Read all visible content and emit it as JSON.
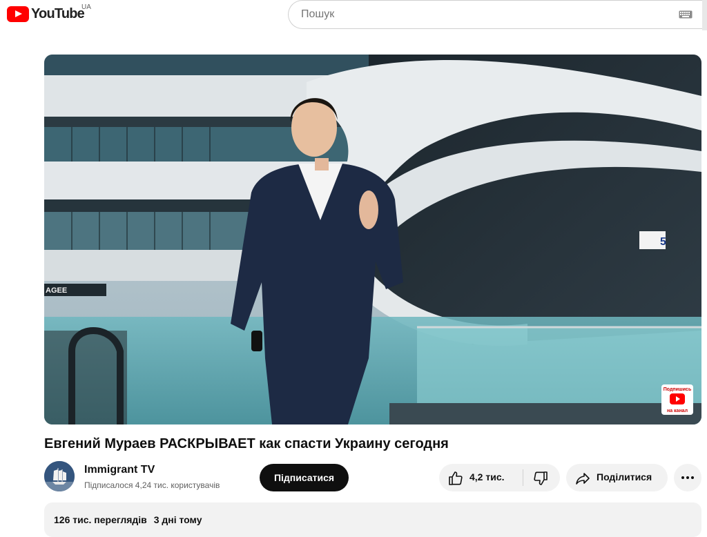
{
  "header": {
    "logo_text": "YouTube",
    "region": "UA",
    "search_placeholder": "Пошук"
  },
  "video": {
    "title": "Евгений Мураев РАСКРЫВАЕТ как спасти Украину сегодня",
    "overlay_badge": "Подпишись на канал",
    "scene_sign": "AGEE"
  },
  "channel": {
    "name": "Immigrant TV",
    "subscribers": "Підписалося 4,24 тис. користувачів",
    "subscribe_label": "Підписатися"
  },
  "actions": {
    "likes": "4,2 тис.",
    "share_label": "Поділитися"
  },
  "description": {
    "views": "126 тис. переглядів",
    "date": "3 дні тому"
  },
  "colors": {
    "brand_red": "#ff0000",
    "subscribe_bg": "#0f0f0f",
    "chip_bg": "#f2f2f2"
  }
}
